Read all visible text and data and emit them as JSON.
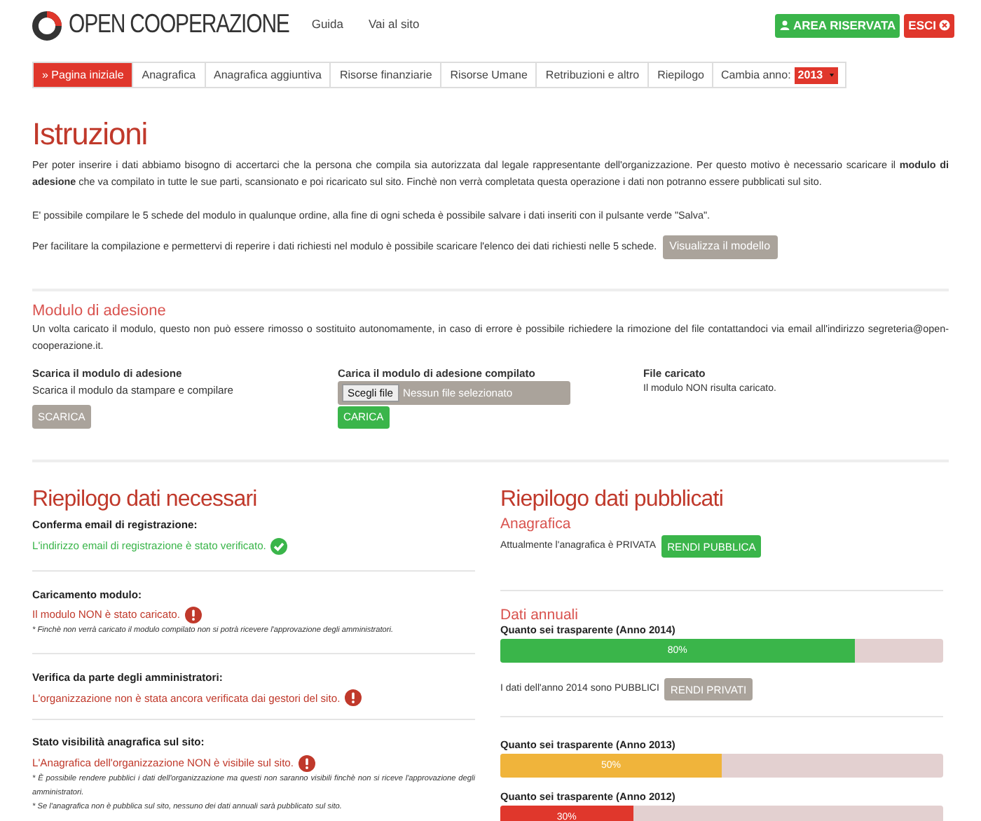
{
  "header": {
    "logo_text": "OPEN COOPERAZIONE",
    "links": [
      "Guida",
      "Vai al sito"
    ],
    "buttons": [
      {
        "label": "AREA RISERVATA",
        "kind": "user"
      },
      {
        "label": "ESCI",
        "kind": "exit"
      }
    ]
  },
  "nav": {
    "tabs": [
      {
        "label": "» Pagina iniziale",
        "selected": true
      },
      {
        "label": "Anagrafica",
        "selected": false
      },
      {
        "label": "Anagrafica aggiuntiva",
        "selected": false
      },
      {
        "label": "Risorse finanziarie",
        "selected": false
      },
      {
        "label": "Risorse Umane",
        "selected": false
      },
      {
        "label": "Retribuzioni e altro",
        "selected": false
      },
      {
        "label": "Riepilogo",
        "selected": false
      }
    ],
    "year_label": "Cambia anno:",
    "year": "2013"
  },
  "instructions": {
    "title": "Istruzioni",
    "paragraphs": [
      "Per poter inserire i dati abbiamo bisogno di accertarci che la persona che compila sia autorizzata dal legale rappresentante dell'organizzazione. Per questo motivo è necessario scaricare il **modulo di adesione** che va compilato in tutte le sue parti, scansionato e poi ricaricato sul sito. Finchè non verrà completata questa operazione i dati non potranno essere pubblicati sul sito.",
      "E' possibile compilare le 5 schede del modulo in qualunque ordine, alla fine di ogni scheda è possibile salvare i dati inseriti con il pulsante verde \"Salva\"."
    ],
    "last_paragraph": "Per facilitare la compilazione e permettervi di reperire i dati richiesti nel modulo è possibile scaricare l'elenco dei dati richiesti nelle 5 schede.",
    "button": "Visualizza il modello"
  },
  "module": {
    "title": "Modulo di adesione",
    "text": "Un volta caricato il modulo, questo non può essere rimosso o sostituito autonomamente, in caso di errore è possibile richiedere la rimozione del file contattandoci via email all'indirizzo segreteria@open-cooperazione.it.",
    "download": {
      "heading": "Scarica il modulo di adesione",
      "text": "Scarica il modulo da stampare e compilare",
      "button": "SCARICA"
    },
    "upload": {
      "heading": "Carica il modulo di adesione compilato",
      "file_button": "Scegli file",
      "file_status": "Nessun file selezionato",
      "button": "CARICA"
    },
    "uploaded": {
      "heading": "File caricato",
      "text": "Il modulo NON risulta caricato."
    }
  },
  "required_summary": {
    "title": "Riepilogo dati necessari",
    "items": [
      {
        "heading": "Conferma email di registrazione:",
        "kind": "ok",
        "status": "L'indirizzo email di registrazione è stato verificato."
      },
      {
        "heading": "Caricamento modulo:",
        "kind": "error",
        "status": "Il modulo NON è stato caricato.",
        "notes": [
          "* Finchè non verrà caricato il modulo compilato non si potrà ricevere l'approvazione degli amministratori."
        ]
      },
      {
        "heading": "Verifica da parte degli amministratori:",
        "kind": "error",
        "status": "L'organizzazione non è stata ancora verificata dai gestori del sito."
      },
      {
        "heading": "Stato visibilità anagrafica sul sito:",
        "kind": "error",
        "status": "L'Anagrafica dell'organizzazione NON è visibile sul sito.",
        "notes": [
          "* È possibile rendere pubblici i dati dell'organizzazione ma questi non saranno visibili finchè non si riceve l'approvazione degli amministratori.",
          "* Se l'anagrafica non è pubblica sul sito, nessuno dei dati annuali sarà pubblicato sul sito."
        ]
      }
    ]
  },
  "published_summary": {
    "title": "Riepilogo dati pubblicati",
    "registry_title": "Anagrafica",
    "registry_text": "Attualmente l'anagrafica è PRIVATA",
    "registry_button": "RENDI PUBBLICA",
    "annual_title": "Dati annuali",
    "years": [
      {
        "heading": "Quanto sei trasparente (Anno 2014)",
        "level": 0.8,
        "reading": "80%",
        "color": "#3ab54a",
        "public_text": "I dati dell'anno 2014 sono PUBBLICI",
        "button": "RENDI PRIVATI"
      },
      {
        "heading": "Quanto sei trasparente (Anno 2013)",
        "level": 0.5,
        "reading": "50%",
        "color": "#f0b43b"
      },
      {
        "heading": "Quanto sei trasparente (Anno 2012)",
        "level": 0.3,
        "reading": "30%",
        "color": "#e0372c"
      }
    ]
  }
}
